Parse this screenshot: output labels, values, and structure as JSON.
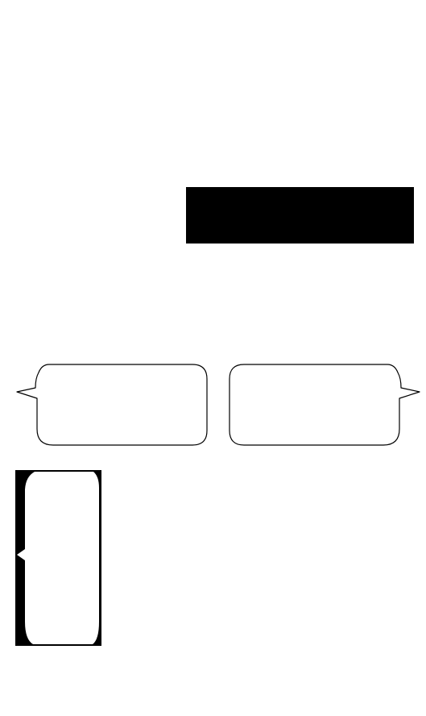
{
  "colors": {
    "background": "#ffffff",
    "shape_fill": "#000000",
    "bubble_outline": "#000000",
    "bubble_fill": "#ffffff"
  },
  "shapes": {
    "top_block": "black-rectangle",
    "bubbles": [
      "speech-bubble-tail-left",
      "speech-bubble-tail-right"
    ],
    "bottom_frame": "black-frame-with-rounded-white-window"
  }
}
